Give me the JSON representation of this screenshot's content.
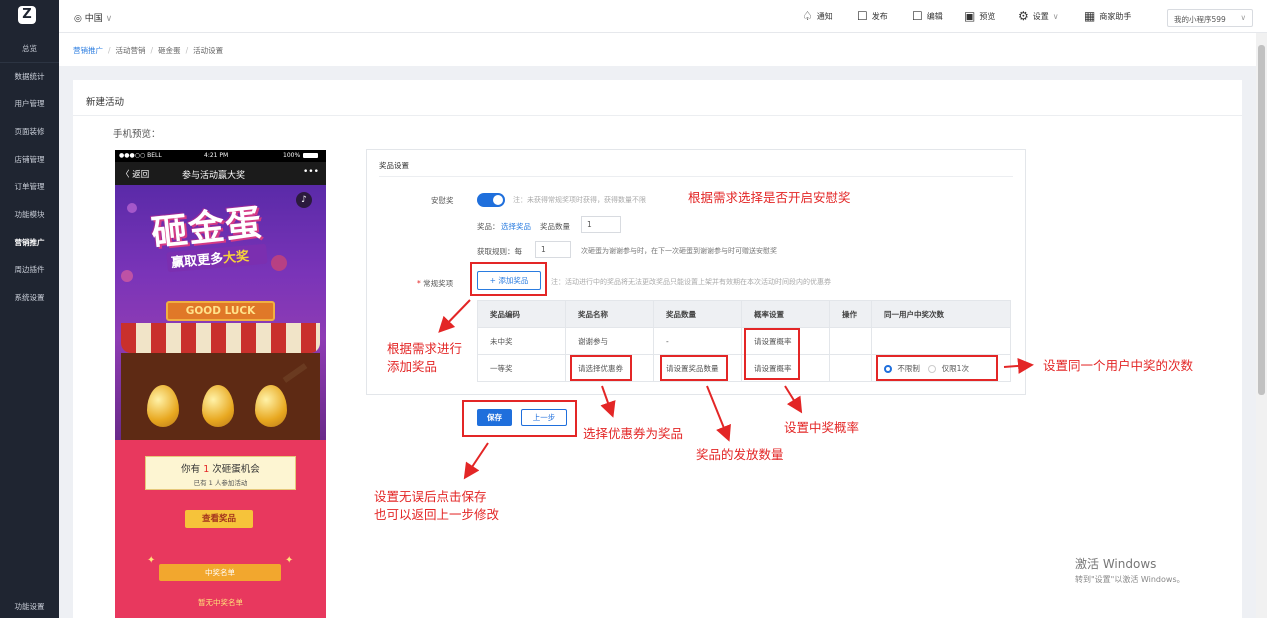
{
  "nav": {
    "items": [
      "总览",
      "数据统计",
      "用户管理",
      "页面装修",
      "店铺管理",
      "订单管理",
      "功能模块",
      "营销推广",
      "周边插件",
      "系统设置"
    ],
    "active": "营销推广",
    "bottom": "功能设置"
  },
  "topbar": {
    "location": "中国",
    "notify": "通知",
    "publish": "发布",
    "edit": "编辑",
    "preview": "预览",
    "settings": "设置",
    "assistant": "商家助手",
    "app_select": "我的小程序599"
  },
  "breadcrumb": [
    "营销推广",
    "活动营销",
    "砸金蛋",
    "活动设置"
  ],
  "page": {
    "title": "新建活动",
    "preview_label": "手机预览："
  },
  "phone": {
    "status_left": "●●●○○ BELL ",
    "status_time": "4:21 PM",
    "status_right": "100%",
    "back": "〈 返回",
    "title": "参与活动赢大奖",
    "more": "•••",
    "banner_main": "砸金蛋",
    "banner_sub_a": "赢取更多",
    "banner_sub_b": "大奖",
    "good_luck": "GOOD LUCK",
    "chance_prefix": "你有",
    "chance_count": "1",
    "chance_suffix": "次砸蛋机会",
    "joined_prefix": "已有",
    "joined_count": "1",
    "joined_suffix": "人参加活动",
    "view_prizes": "查看奖品",
    "winner_list": "中奖名单",
    "no_winners": "暂无中奖名单"
  },
  "settings": {
    "section_title": "奖品设置",
    "consolation_label": "安慰奖",
    "consolation_note": "注：未获得常规奖项时获得，获得数量不限",
    "prize_label": "奖品：",
    "select_prize": "选择奖品",
    "prize_qty_label": "奖品数量",
    "prize_qty": "1",
    "rule_label": "获取规则：每",
    "rule_value": "1",
    "rule_note": "次砸蛋为谢谢参与时，在下一次砸蛋到谢谢参与时可赠送安慰奖",
    "regular_label": "常规奖项",
    "add_prize": "+ 添加奖品",
    "regular_note": "注：活动进行中的奖品将无法更改奖品只能设置上架并有效期在本次活动时间段内的优惠券",
    "table": {
      "headers": [
        "奖品编码",
        "奖品名称",
        "奖品数量",
        "概率设置",
        "操作",
        "同一用户中奖次数"
      ],
      "rows": [
        [
          "未中奖",
          "谢谢参与",
          "-",
          "请设置概率",
          "",
          ""
        ],
        [
          "一等奖",
          "请选择优惠券",
          "请设置奖品数量",
          "请设置概率",
          "",
          ""
        ]
      ],
      "limit_options": [
        "不限制",
        "仅限1次"
      ]
    },
    "save": "保存",
    "prev": "上一步"
  },
  "annotations": {
    "consolation": "根据需求选择是否开启安慰奖",
    "add_prize_1": "根据需求进行",
    "add_prize_2": "添加奖品",
    "limit": "设置同一个用户中奖的次数",
    "coupon": "选择优惠券为奖品",
    "probability": "设置中奖概率",
    "quantity": "奖品的发放数量",
    "save_1": "设置无误后点击保存",
    "save_2": "也可以返回上一步修改"
  },
  "watermark": {
    "line1": "激活 Windows",
    "line2": "转到\"设置\"以激活 Windows。"
  },
  "colors": {
    "primary": "#1f6fdc",
    "annotation": "#e32626",
    "nav_bg": "#1f2531"
  }
}
